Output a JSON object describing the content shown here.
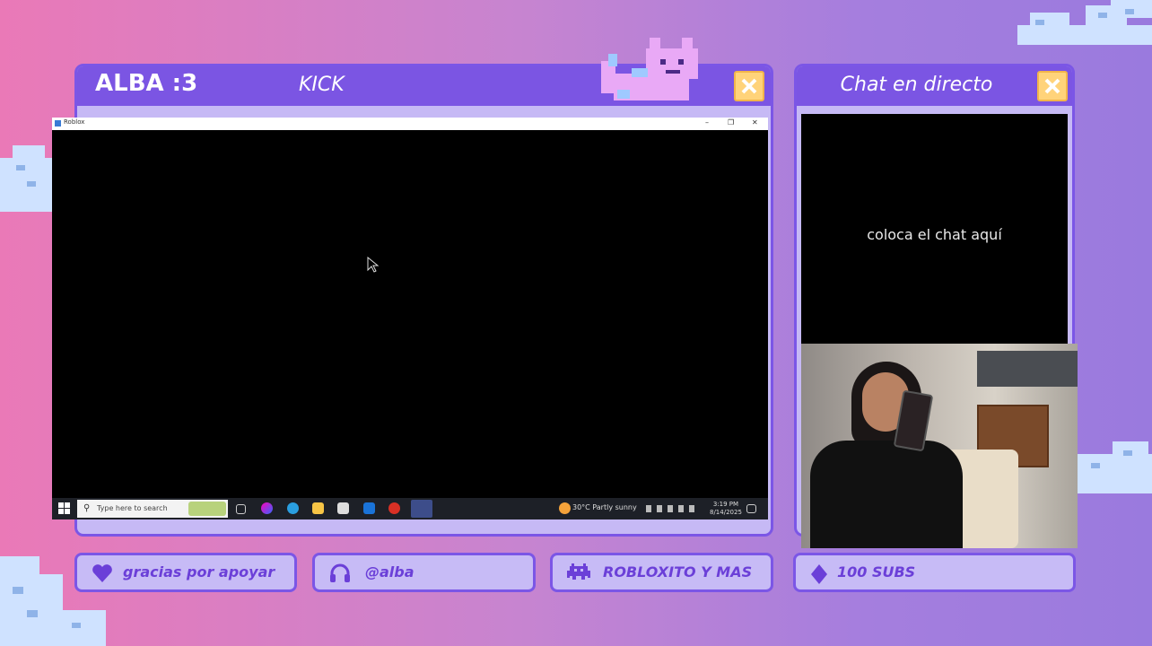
{
  "overlay": {
    "streamer_name": "ALBA :3",
    "platform": "KICK",
    "chat_title": "Chat en directo",
    "chat_placeholder": "coloca el chat aquí"
  },
  "game_window": {
    "title": "Roblox",
    "controls": [
      "–",
      "❐",
      "✕"
    ]
  },
  "taskbar": {
    "search_placeholder": "Type here to search",
    "weather": "30°C  Partly sunny",
    "time": "3:19 PM",
    "date": "8/14/2025"
  },
  "bottom_buttons": [
    {
      "label": "gracias por apoyar",
      "icon": "heart-icon"
    },
    {
      "label": "@alba",
      "icon": "headphones-icon"
    },
    {
      "label": "ROBLOXITO Y MAS",
      "icon": "space-invader-icon"
    },
    {
      "label": "100 SUBS",
      "icon": "diamond-icon"
    }
  ],
  "colors": {
    "accent": "#7b55e3",
    "panel": "#c6b9f5",
    "close": "#ffd37a",
    "text_accent": "#6b3fd8"
  }
}
